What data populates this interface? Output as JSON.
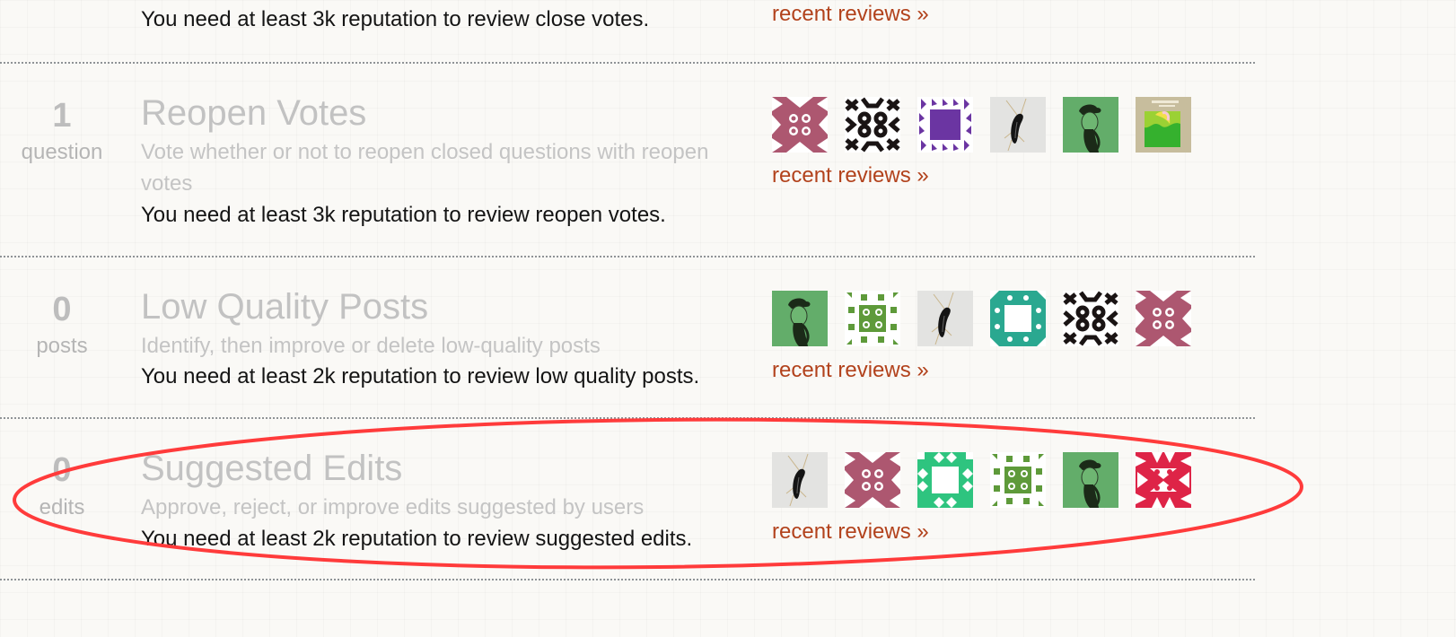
{
  "queues": [
    {
      "id": "close-votes",
      "requirement": "You need at least 3k reputation to review close votes.",
      "recent_link": "recent reviews »"
    },
    {
      "id": "reopen-votes",
      "count": "1",
      "unit": "question",
      "title": "Reopen Votes",
      "description": "Vote whether or not to reopen closed questions with reopen votes",
      "requirement": "You need at least 3k reputation to review reopen votes.",
      "recent_link": "recent reviews »",
      "reviewers": [
        "identicon-pink",
        "identicon-black",
        "identicon-purple",
        "photo-insect",
        "photo-portrait-green",
        "photo-book-cover"
      ]
    },
    {
      "id": "low-quality-posts",
      "count": "0",
      "unit": "posts",
      "title": "Low Quality Posts",
      "description": "Identify, then improve or delete low-quality posts",
      "requirement": "You need at least 2k reputation to review low quality posts.",
      "recent_link": "recent reviews »",
      "reviewers": [
        "photo-portrait-green",
        "identicon-green",
        "photo-insect",
        "identicon-teal",
        "identicon-black",
        "identicon-pink"
      ]
    },
    {
      "id": "suggested-edits",
      "count": "0",
      "unit": "edits",
      "title": "Suggested Edits",
      "description": "Approve, reject, or improve edits suggested by users",
      "requirement": "You need at least 2k reputation to review suggested edits.",
      "recent_link": "recent reviews »",
      "reviewers": [
        "photo-insect",
        "identicon-pink",
        "identicon-mint",
        "identicon-green",
        "photo-portrait-green",
        "identicon-red"
      ],
      "highlighted": true
    }
  ],
  "colors": {
    "link": "#b2421c",
    "muted_text": "#c2c2c2",
    "annotation": "#ff3b3b"
  }
}
